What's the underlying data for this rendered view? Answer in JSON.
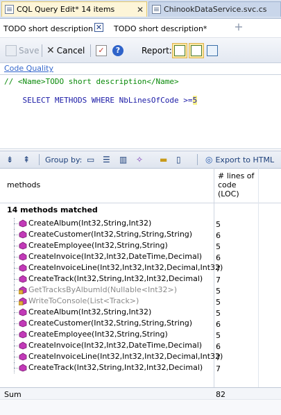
{
  "doc_tabs": [
    {
      "label": "CQL Query Edit* 14 items",
      "active": true
    },
    {
      "label": "ChinookDataService.svc.cs",
      "active": false
    }
  ],
  "query_tabs": [
    {
      "label": "TODO short description",
      "active": true
    },
    {
      "label": "TODO short description*",
      "active": false
    }
  ],
  "toolbar": {
    "save_label": "Save",
    "cancel_label": "Cancel",
    "report_label": "Report:"
  },
  "code_quality_link": "Code Quality",
  "editor": {
    "line1": "// <Name>TODO short description</Name>",
    "line2_prefix": "SELECT METHODS WHERE NbLinesOfCode >=",
    "line2_value": "5"
  },
  "results_toolbar": {
    "group_by_label": "Group by:",
    "export_label": "Export to HTML"
  },
  "grid": {
    "col_methods": "methods",
    "col_loc": "# lines of code (LOC)",
    "group_label": "14 methods matched",
    "rows": [
      {
        "name": "CreateAlbum(Int32,String,Int32)",
        "loc": "5",
        "dim": false
      },
      {
        "name": "CreateCustomer(Int32,String,String,String)",
        "loc": "6",
        "dim": false
      },
      {
        "name": "CreateEmployee(Int32,String,String)",
        "loc": "5",
        "dim": false
      },
      {
        "name": "CreateInvoice(Int32,Int32,DateTime,Decimal)",
        "loc": "6",
        "dim": false
      },
      {
        "name": "CreateInvoiceLine(Int32,Int32,Int32,Decimal,Int32)",
        "loc": "7",
        "dim": false
      },
      {
        "name": "CreateTrack(Int32,String,Int32,Int32,Decimal)",
        "loc": "7",
        "dim": false
      },
      {
        "name": "GetTracksByAlbumId(Nullable<Int32>)",
        "loc": "5",
        "dim": true
      },
      {
        "name": "WriteToConsole(List<Track>)",
        "loc": "5",
        "dim": true
      },
      {
        "name": "CreateAlbum(Int32,String,Int32)",
        "loc": "5",
        "dim": false
      },
      {
        "name": "CreateCustomer(Int32,String,String,String)",
        "loc": "6",
        "dim": false
      },
      {
        "name": "CreateEmployee(Int32,String,String)",
        "loc": "5",
        "dim": false
      },
      {
        "name": "CreateInvoice(Int32,Int32,DateTime,Decimal)",
        "loc": "6",
        "dim": false
      },
      {
        "name": "CreateInvoiceLine(Int32,Int32,Int32,Decimal,Int32)",
        "loc": "7",
        "dim": false
      },
      {
        "name": "CreateTrack(Int32,String,Int32,Int32,Decimal)",
        "loc": "7",
        "dim": false
      }
    ],
    "sum_label": "Sum",
    "sum_value": "82"
  },
  "colors": {
    "method_icon": "#c23ab8",
    "comment": "#0a8a0a",
    "keyword": "#1a1aa6"
  }
}
